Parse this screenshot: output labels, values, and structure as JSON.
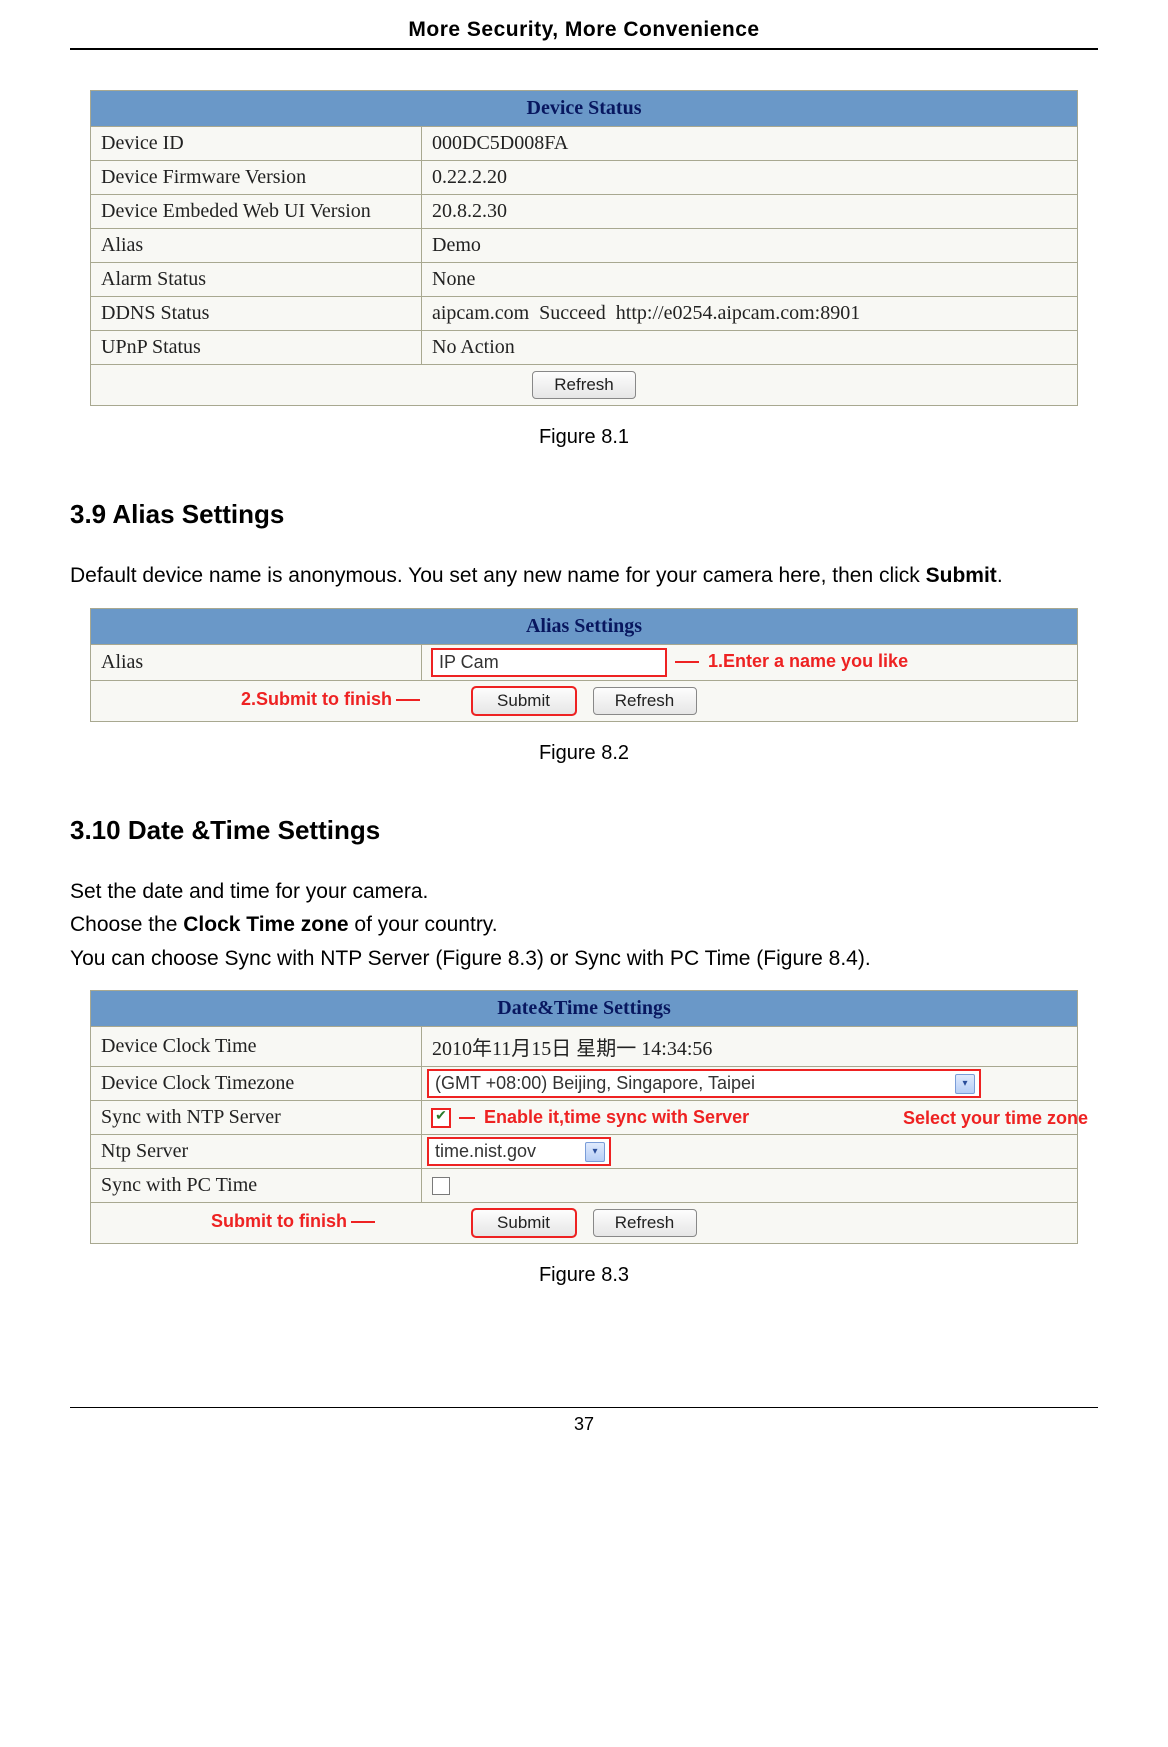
{
  "header": "More Security, More Convenience",
  "page_number": "37",
  "fig81": {
    "title": "Device Status",
    "rows": [
      {
        "label": "Device ID",
        "value": "000DC5D008FA"
      },
      {
        "label": "Device Firmware Version",
        "value": "0.22.2.20"
      },
      {
        "label": "Device Embeded Web UI Version",
        "value": "20.8.2.30"
      },
      {
        "label": "Alias",
        "value": "Demo"
      },
      {
        "label": "Alarm Status",
        "value": "None"
      },
      {
        "label": "DDNS Status",
        "value": "aipcam.com  Succeed  http://e0254.aipcam.com:8901"
      },
      {
        "label": "UPnP Status",
        "value": "No Action"
      }
    ],
    "refresh": "Refresh",
    "caption": "Figure 8.1"
  },
  "sec39": {
    "heading": "3.9 Alias Settings",
    "line1a": "Default device name is anonymous. You set any new name for your camera here, then click ",
    "line1b": "Submit",
    "line1c": "."
  },
  "fig82": {
    "title": "Alias Settings",
    "alias_label": "Alias",
    "alias_value": "IP Cam",
    "submit": "Submit",
    "refresh": "Refresh",
    "ann1": "1.Enter a name you like",
    "ann2": "2.Submit to finish",
    "caption": "Figure 8.2"
  },
  "sec310": {
    "heading": "3.10 Date &Time Settings",
    "p1": "Set the date and time for your camera.",
    "p2a": "Choose the ",
    "p2b": "Clock Time zone",
    "p2c": " of your country.",
    "p3": "You can choose Sync with NTP Server (Figure 8.3) or Sync with PC Time (Figure 8.4)."
  },
  "fig83": {
    "title": "Date&Time Settings",
    "rows": {
      "clock_time_label": "Device Clock Time",
      "clock_time_value": "2010年11月15日  星期一  14:34:56",
      "tz_label": "Device Clock Timezone",
      "tz_value": "(GMT +08:00) Beijing, Singapore, Taipei",
      "ntp_sync_label": "Sync with NTP Server",
      "ntp_sync_checked": true,
      "ntp_server_label": "Ntp Server",
      "ntp_server_value": "time.nist.gov",
      "pc_sync_label": "Sync with PC Time",
      "pc_sync_checked": false
    },
    "submit": "Submit",
    "refresh": "Refresh",
    "ann_enable": "Enable it,time sync with Server",
    "ann_tz": "Select your time zone",
    "ann_submit": "Submit to finish",
    "caption": "Figure 8.3"
  }
}
